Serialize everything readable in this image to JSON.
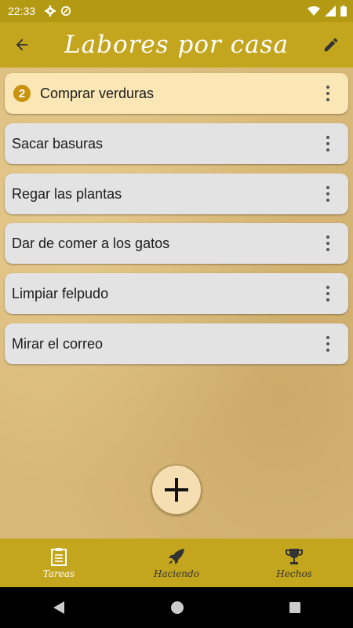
{
  "status": {
    "time": "22:33"
  },
  "app_bar": {
    "title": "Labores por casa"
  },
  "tasks": [
    {
      "label": "Comprar verduras",
      "badge": "2"
    },
    {
      "label": "Sacar basuras"
    },
    {
      "label": "Regar las plantas"
    },
    {
      "label": "Dar de comer a los gatos"
    },
    {
      "label": "Limpiar felpudo"
    },
    {
      "label": "Mirar el correo"
    }
  ],
  "bottom_nav": [
    {
      "label": "Tareas",
      "icon": "clipboard-icon",
      "active": true
    },
    {
      "label": "Haciendo",
      "icon": "rocket-icon",
      "active": false
    },
    {
      "label": "Hechos",
      "icon": "trophy-icon",
      "active": false
    }
  ],
  "colors": {
    "accent": "#c4a61e",
    "badge": "#c9930e",
    "highlight": "#fbe7b5"
  }
}
